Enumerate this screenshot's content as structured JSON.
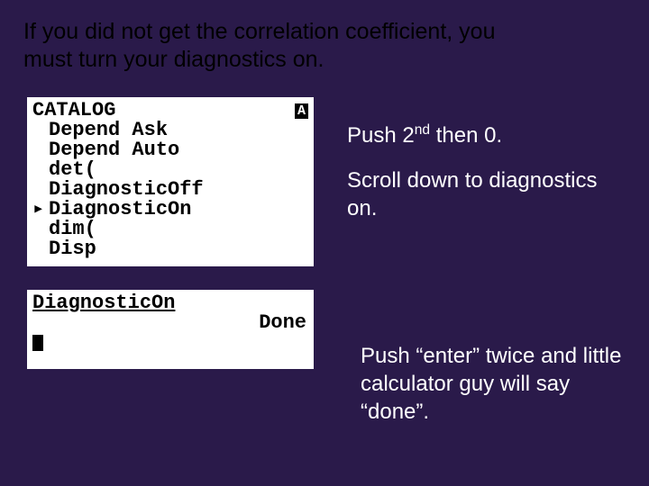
{
  "title": "If you did not get the correlation coefficient, you must turn your diagnostics on.",
  "screen1": {
    "header": "CATALOG",
    "tag": "A",
    "items": [
      "Depend Ask",
      "Depend Auto",
      "det(",
      "DiagnosticOff",
      "DiagnosticOn",
      "dim(",
      "Disp"
    ],
    "selected_index": 4,
    "pointer": "▸"
  },
  "screen2": {
    "command": "DiagnosticOn",
    "result": "Done"
  },
  "instruction1_pre": "Push 2",
  "instruction1_sup": "nd",
  "instruction1_post": " then 0.",
  "instruction2": "Scroll down to diagnostics on.",
  "instruction3": "Push “enter” twice and little calculator guy will say “done”."
}
